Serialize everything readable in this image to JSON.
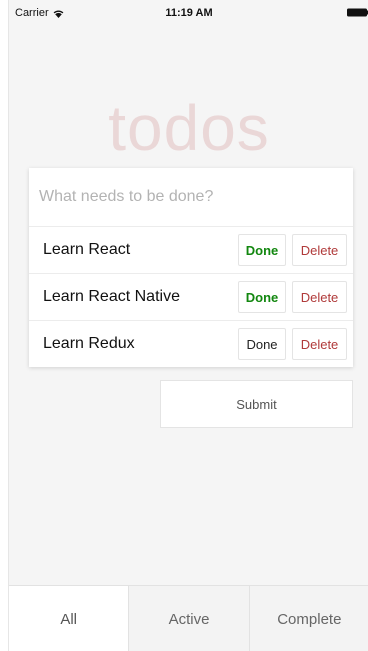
{
  "status_bar": {
    "carrier": "Carrier",
    "time": "11:19 AM"
  },
  "app": {
    "title": "todos"
  },
  "new_todo": {
    "placeholder": "What needs to be done?",
    "value": ""
  },
  "todos": [
    {
      "text": "Learn React",
      "done_label": "Done",
      "delete_label": "Delete",
      "completed": true
    },
    {
      "text": "Learn React Native",
      "done_label": "Done",
      "delete_label": "Delete",
      "completed": true
    },
    {
      "text": "Learn Redux",
      "done_label": "Done",
      "delete_label": "Delete",
      "completed": false
    }
  ],
  "submit": {
    "label": "Submit"
  },
  "tabs": [
    {
      "label": "All",
      "active": true
    },
    {
      "label": "Active",
      "active": false
    },
    {
      "label": "Complete",
      "active": false
    }
  ],
  "colors": {
    "title": "#ead7d7",
    "done_complete": "#12870f",
    "delete": "#b03a3a",
    "background": "#f5f5f5"
  }
}
